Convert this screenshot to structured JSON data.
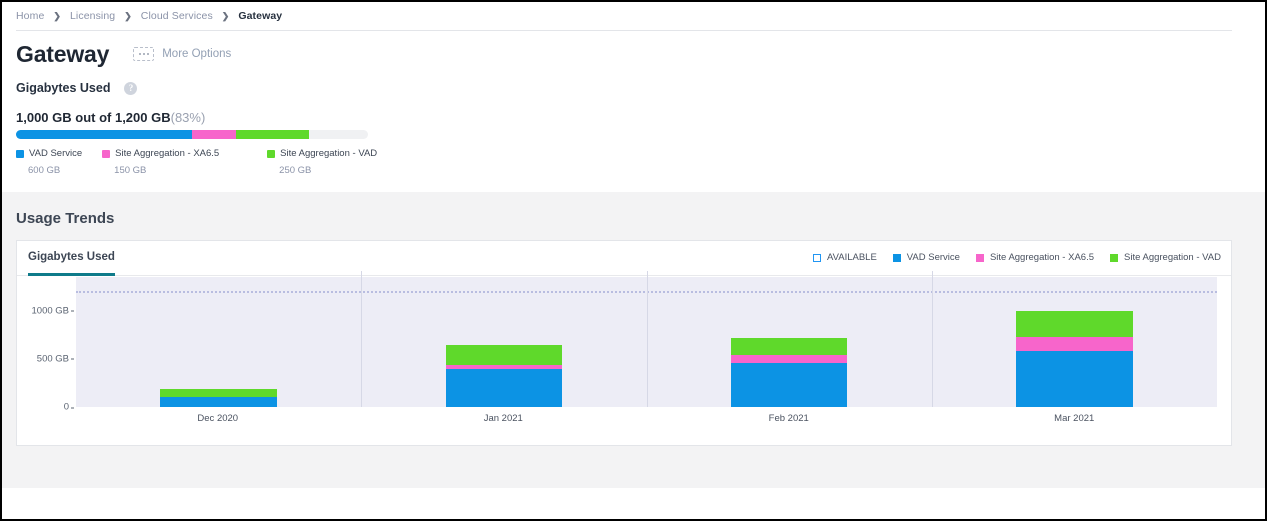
{
  "breadcrumb": {
    "items": [
      {
        "label": "Home",
        "current": false
      },
      {
        "label": "Licensing",
        "current": false
      },
      {
        "label": "Cloud Services",
        "current": false
      },
      {
        "label": "Gateway",
        "current": true
      }
    ],
    "separator": "❯"
  },
  "header": {
    "title": "Gateway",
    "more_options_label": "More Options",
    "more_options_icon": "ellipsis-icon"
  },
  "summary": {
    "section_label": "Gigabytes Used",
    "help_icon": "help-icon",
    "help_glyph": "?",
    "used_text": "1,000 GB out of 1,200 GB",
    "percent_text": "(83%)",
    "total_gb": 1200,
    "used_gb": 1000,
    "segments": [
      {
        "label": "VAD Service",
        "value_text": "600 GB",
        "value_gb": 600,
        "color": "#0c93e4"
      },
      {
        "label": "Site Aggregation - XA6.5",
        "value_text": "150 GB",
        "value_gb": 150,
        "color": "#f765cb"
      },
      {
        "label": "Site Aggregation - VAD",
        "value_text": "250 GB",
        "value_gb": 250,
        "color": "#5fd92b"
      }
    ],
    "track_color": "#f0f1f3"
  },
  "trends": {
    "title": "Usage Trends",
    "tab_label": "Gigabytes Used",
    "tab_accent": "#0f7b8a",
    "legend": [
      {
        "label": "AVAILABLE",
        "color": "#ffffff",
        "style": "hollow",
        "outline": "#2196f3"
      },
      {
        "label": "VAD Service",
        "color": "#0c93e4",
        "style": "solid"
      },
      {
        "label": "Site Aggregation - XA6.5",
        "color": "#f765cb",
        "style": "solid"
      },
      {
        "label": "Site Aggregation - VAD",
        "color": "#5fd92b",
        "style": "solid"
      }
    ]
  },
  "chart_data": {
    "type": "bar",
    "stacked": true,
    "title": "Gigabytes Used",
    "xlabel": "",
    "ylabel": "",
    "categories": [
      "Dec 2020",
      "Jan 2021",
      "Feb 2021",
      "Mar 2021"
    ],
    "ytick_labels": [
      "1000 GB",
      "500 GB",
      "0"
    ],
    "ytick_values": [
      1000,
      500,
      0
    ],
    "ylim": [
      0,
      1350
    ],
    "grid": false,
    "limit_line": {
      "value": 1200,
      "label": "",
      "style": "dotted",
      "color": "#b9bde0"
    },
    "legend_position": "top-right",
    "plot_background": "#ededf6",
    "series": [
      {
        "name": "VAD Service",
        "color": "#0c93e4",
        "values": [
          104,
          396,
          458,
          583
        ]
      },
      {
        "name": "Site Aggregation - XA6.5",
        "color": "#f765cb",
        "values": [
          0,
          42,
          83,
          146
        ]
      },
      {
        "name": "Site Aggregation - VAD",
        "color": "#5fd92b",
        "values": [
          83,
          208,
          177,
          271
        ]
      }
    ],
    "totals": [
      187,
      646,
      718,
      1000
    ]
  }
}
